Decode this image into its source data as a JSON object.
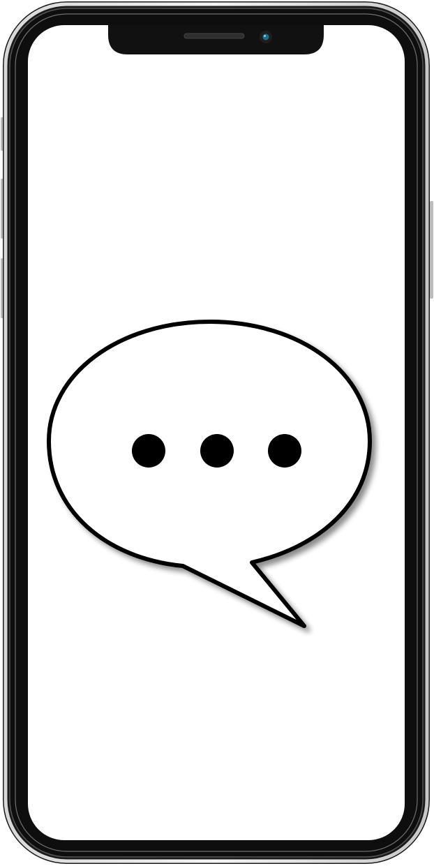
{
  "device": {
    "model": "smartphone",
    "frame_color": "#111111",
    "screen_color": "#ffffff",
    "camera_lens_color": "#1c6f86"
  },
  "screen": {
    "content_icon": "speech-bubble-typing-icon",
    "bubble_fill": "#ffffff",
    "bubble_stroke": "#000000",
    "typing_dots_count": 3,
    "typing_dot_color": "#000000"
  }
}
